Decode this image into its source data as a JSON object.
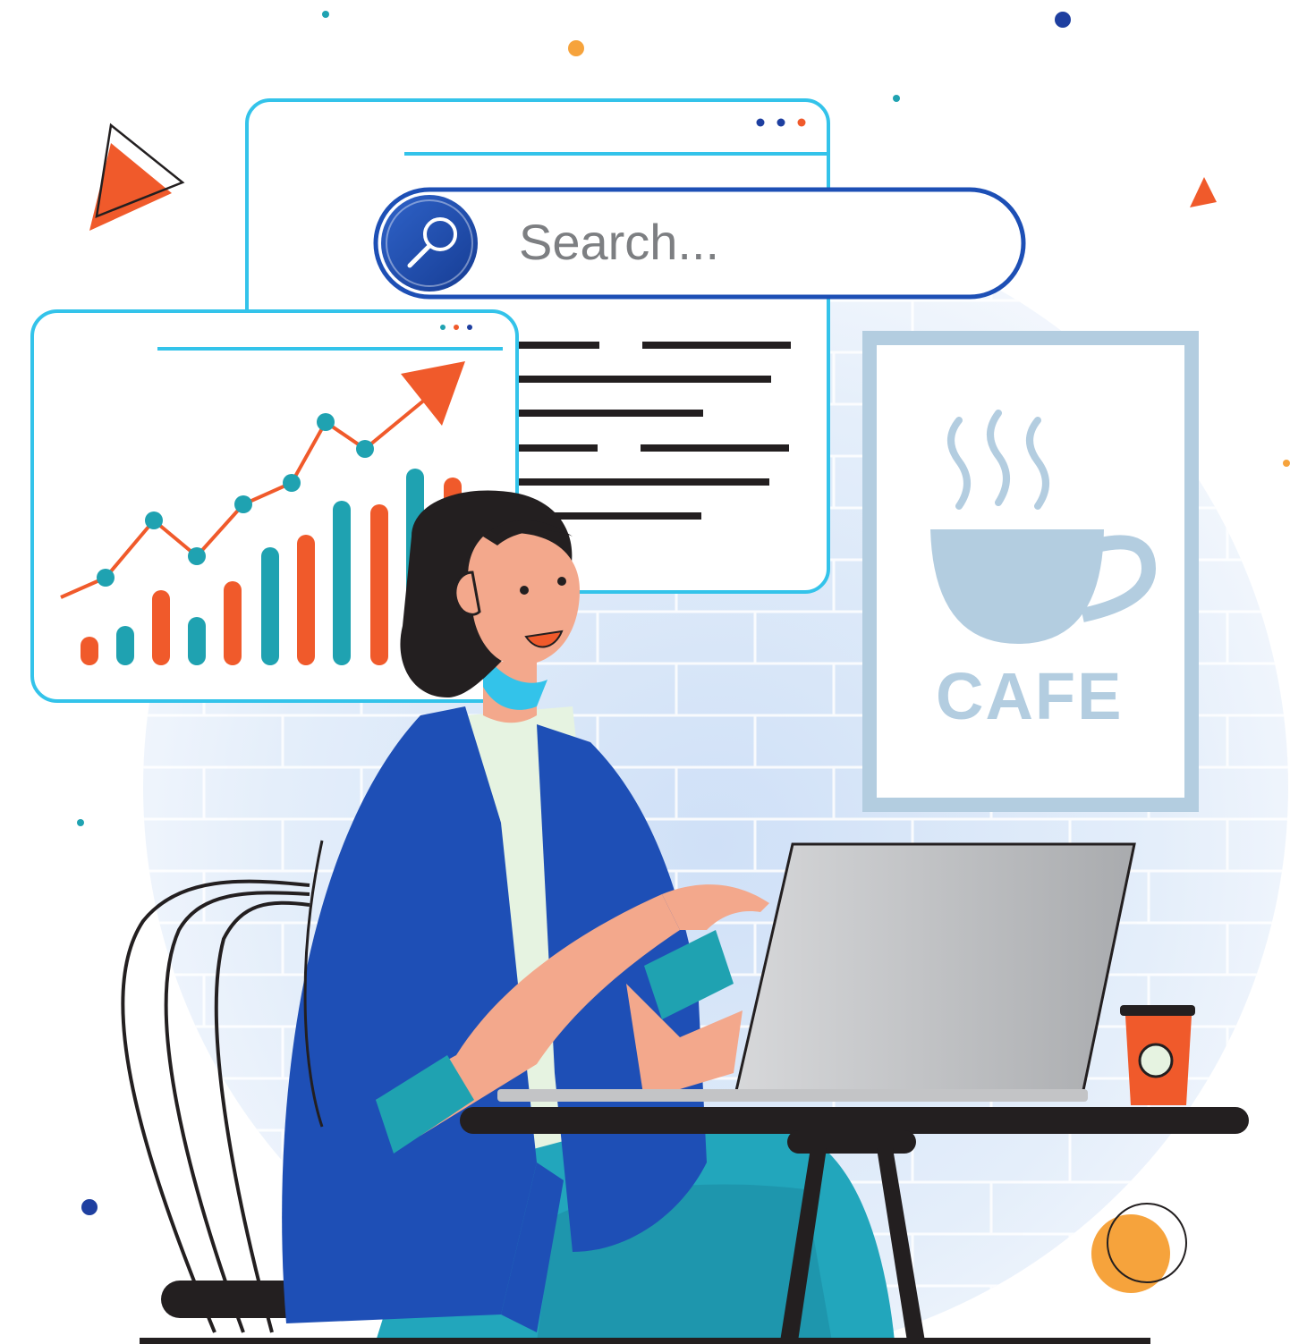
{
  "search": {
    "placeholder": "Search..."
  },
  "poster": {
    "label": "CAFE"
  },
  "colors": {
    "window_border": "#33c3ea",
    "search_border": "#1d4fb5",
    "accent_orange": "#f05a2b",
    "accent_teal": "#1fa2b1",
    "jacket_blue": "#1e4fb6",
    "pants_teal": "#22a6bc",
    "laptop_gray": "#c3c4c6",
    "skin": "#f3a88c",
    "hair": "#231f20",
    "wall_tint": "#dde9f8",
    "poster_blue": "#b3cde0"
  },
  "icons": [
    "search-icon",
    "play-triangle-icon",
    "window-dots-icon",
    "arrow-up-icon",
    "coffee-cup-icon",
    "steam-icon"
  ]
}
